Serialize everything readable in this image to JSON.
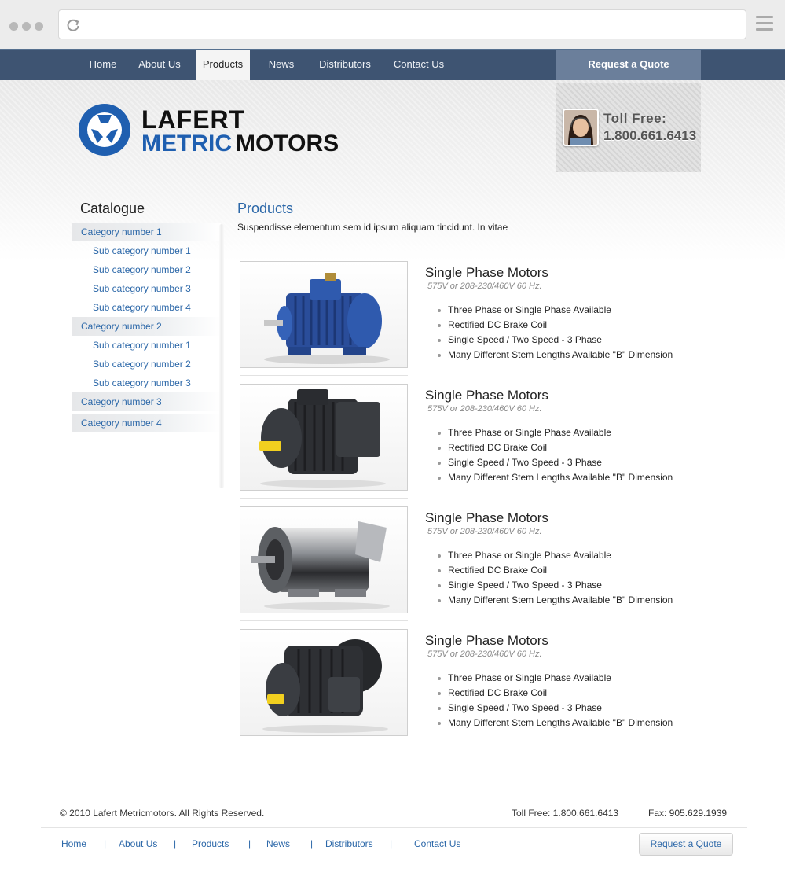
{
  "nav": {
    "items": [
      "Home",
      "About Us",
      "Products",
      "News",
      "Distributors",
      "Contact Us"
    ],
    "active": "Products",
    "quote_label": "Request a Quote"
  },
  "header": {
    "logo_line1": "LAFERT",
    "logo_line2a": "METRIC",
    "logo_line2b": "MOTORS",
    "toll_label": "Toll Free:",
    "toll_number": "1.800.661.6413"
  },
  "sidebar": {
    "title": "Catalogue",
    "items": [
      {
        "label": "Category number 1",
        "level": "top"
      },
      {
        "label": "Sub category number 1",
        "level": "sub"
      },
      {
        "label": "Sub category number 2",
        "level": "sub"
      },
      {
        "label": "Sub category number 3",
        "level": "sub"
      },
      {
        "label": "Sub category number 4",
        "level": "sub"
      },
      {
        "label": "Category number 2",
        "level": "top"
      },
      {
        "label": "Sub category number 1",
        "level": "sub"
      },
      {
        "label": "Sub category number 2",
        "level": "sub"
      },
      {
        "label": "Sub category number 3",
        "level": "sub"
      },
      {
        "label": "Category number 3",
        "level": "top"
      },
      {
        "label": "Category number 4",
        "level": "top"
      }
    ]
  },
  "main": {
    "title": "Products",
    "intro": "Suspendisse elementum sem id ipsum aliquam tincidunt. In vitae",
    "products": [
      {
        "name": "Single Phase Motors",
        "spec": "575V or 208-230/460V 60 Hz.",
        "image": "blue-motor",
        "features": [
          "Three Phase or Single Phase Available",
          "Rectified DC Brake Coil",
          "Single Speed / Two Speed - 3 Phase",
          "Many Different Stem Lengths Available \"B\" Dimension"
        ]
      },
      {
        "name": "Single Phase Motors",
        "spec": "575V or 208-230/460V 60 Hz.",
        "image": "black-motor-box",
        "features": [
          "Three Phase or Single Phase Available",
          "Rectified DC Brake Coil",
          "Single Speed / Two Speed - 3 Phase",
          "Many Different Stem Lengths Available \"B\" Dimension"
        ]
      },
      {
        "name": "Single Phase Motors",
        "spec": "575V or 208-230/460V 60 Hz.",
        "image": "steel-motor",
        "features": [
          "Three Phase or Single Phase Available",
          "Rectified DC Brake Coil",
          "Single Speed / Two Speed - 3 Phase",
          "Many Different Stem Lengths Available \"B\" Dimension"
        ]
      },
      {
        "name": "Single Phase Motors",
        "spec": "575V or 208-230/460V 60 Hz.",
        "image": "black-motor",
        "features": [
          "Three Phase or Single Phase Available",
          "Rectified DC Brake Coil",
          "Single Speed / Two Speed - 3 Phase",
          "Many Different Stem Lengths Available \"B\" Dimension"
        ]
      }
    ]
  },
  "footer": {
    "copyright": "© 2010 Lafert Metricmotors. All Rights Reserved.",
    "toll": "Toll Free: 1.800.661.6413",
    "fax": "Fax: 905.629.1939",
    "links": [
      "Home",
      "About Us",
      "Products",
      "News",
      "Distributors",
      "Contact Us"
    ],
    "separator": "|",
    "quote_label": "Request a Quote"
  },
  "colors": {
    "nav_bg": "#3e5472",
    "link": "#2b67a8",
    "logo_blue": "#1f5fb0"
  }
}
